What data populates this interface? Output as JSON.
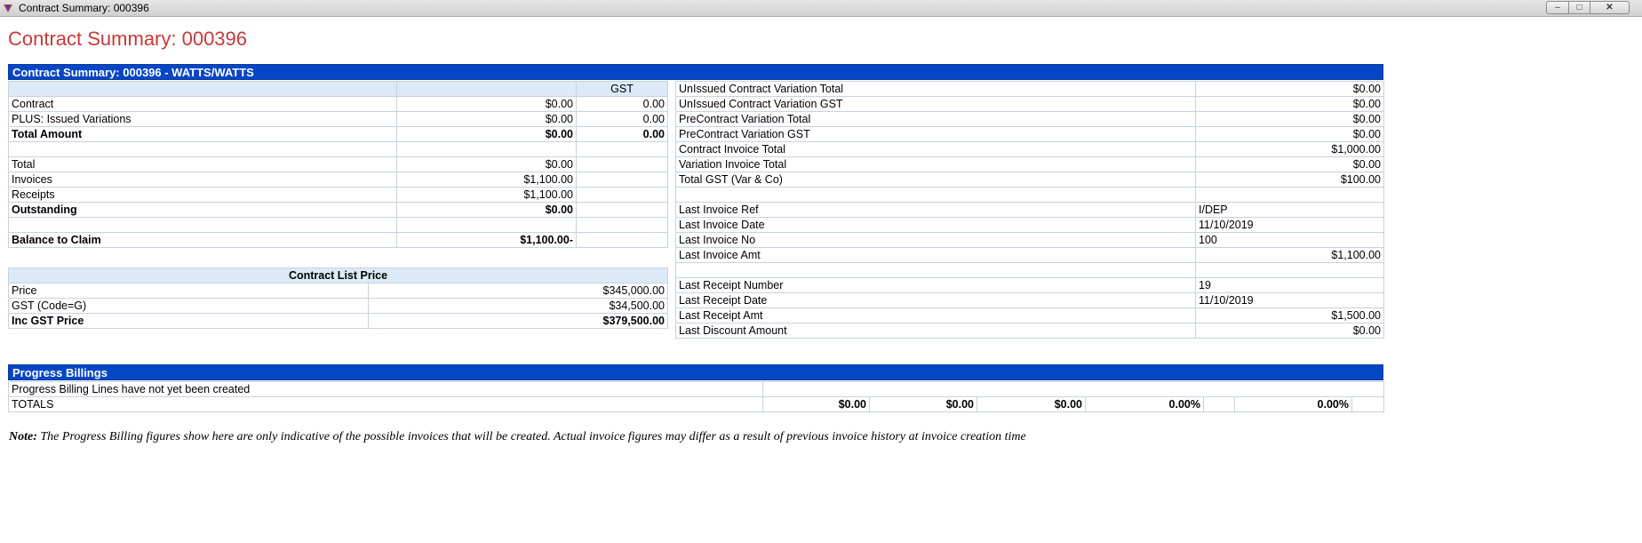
{
  "window": {
    "title": "Contract Summary: 000396"
  },
  "page": {
    "title": "Contract Summary: 000396"
  },
  "summary": {
    "header": "Contract Summary: 000396 - WATTS/WATTS",
    "gst_label": "GST",
    "rows": [
      {
        "label": "Contract",
        "amount": "$0.00",
        "gst": "0.00",
        "bold": false
      },
      {
        "label": "PLUS: Issued Variations",
        "amount": "$0.00",
        "gst": "0.00",
        "bold": false
      },
      {
        "label": "Total Amount",
        "amount": "$0.00",
        "gst": "0.00",
        "bold": true
      },
      {
        "label": "",
        "amount": "",
        "gst": "",
        "bold": false
      },
      {
        "label": "Total",
        "amount": "$0.00",
        "gst": "",
        "bold": false
      },
      {
        "label": "Invoices",
        "amount": "$1,100.00",
        "gst": "",
        "bold": false
      },
      {
        "label": "Receipts",
        "amount": "$1,100.00",
        "gst": "",
        "bold": false
      },
      {
        "label": "Outstanding",
        "amount": "$0.00",
        "gst": "",
        "bold": true
      },
      {
        "label": "",
        "amount": "",
        "gst": "",
        "bold": false
      },
      {
        "label": "Balance to Claim",
        "amount": "$1,100.00-",
        "gst": "",
        "bold": true
      }
    ]
  },
  "list_price": {
    "header": "Contract List Price",
    "rows": [
      {
        "label": "Price",
        "value": "$345,000.00",
        "bold": false
      },
      {
        "label": "GST (Code=G)",
        "value": "$34,500.00",
        "bold": false
      },
      {
        "label": "Inc GST Price",
        "value": "$379,500.00",
        "bold": true
      }
    ]
  },
  "right_info": {
    "rows": [
      {
        "label": "UnIssued Contract Variation Total",
        "value": "$0.00",
        "align": "right"
      },
      {
        "label": "UnIssued Contract Variation GST",
        "value": "$0.00",
        "align": "right"
      },
      {
        "label": "PreContract Variation Total",
        "value": "$0.00",
        "align": "right"
      },
      {
        "label": "PreContract Variation GST",
        "value": "$0.00",
        "align": "right"
      },
      {
        "label": "Contract Invoice Total",
        "value": "$1,000.00",
        "align": "right"
      },
      {
        "label": "Variation Invoice Total",
        "value": "$0.00",
        "align": "right"
      },
      {
        "label": "Total GST (Var & Co)",
        "value": "$100.00",
        "align": "right"
      },
      {
        "label": "",
        "value": "",
        "align": "right"
      },
      {
        "label": "Last Invoice Ref",
        "value": "I/DEP",
        "align": "left"
      },
      {
        "label": "Last Invoice Date",
        "value": "11/10/2019",
        "align": "left"
      },
      {
        "label": "Last Invoice No",
        "value": "100",
        "align": "left"
      },
      {
        "label": "Last Invoice Amt",
        "value": "$1,100.00",
        "align": "right"
      },
      {
        "label": "",
        "value": "",
        "align": "right"
      },
      {
        "label": "Last Receipt Number",
        "value": "19",
        "align": "left"
      },
      {
        "label": "Last Receipt Date",
        "value": "11/10/2019",
        "align": "left"
      },
      {
        "label": "Last Receipt Amt",
        "value": "$1,500.00",
        "align": "right"
      },
      {
        "label": "Last Discount Amount",
        "value": "$0.00",
        "align": "right"
      }
    ]
  },
  "progress": {
    "header": "Progress Billings",
    "message": "Progress Billing Lines have not yet been created",
    "totals_label": "TOTALS",
    "totals": [
      "$0.00",
      "$0.00",
      "$0.00",
      "0.00%",
      "",
      "0.00%",
      ""
    ]
  },
  "note": {
    "label": "Note:",
    "text": " The Progress Billing figures show here are only indicative of the possible invoices that will be created. Actual invoice figures may differ as a result of previous invoice history at invoice creation time"
  }
}
